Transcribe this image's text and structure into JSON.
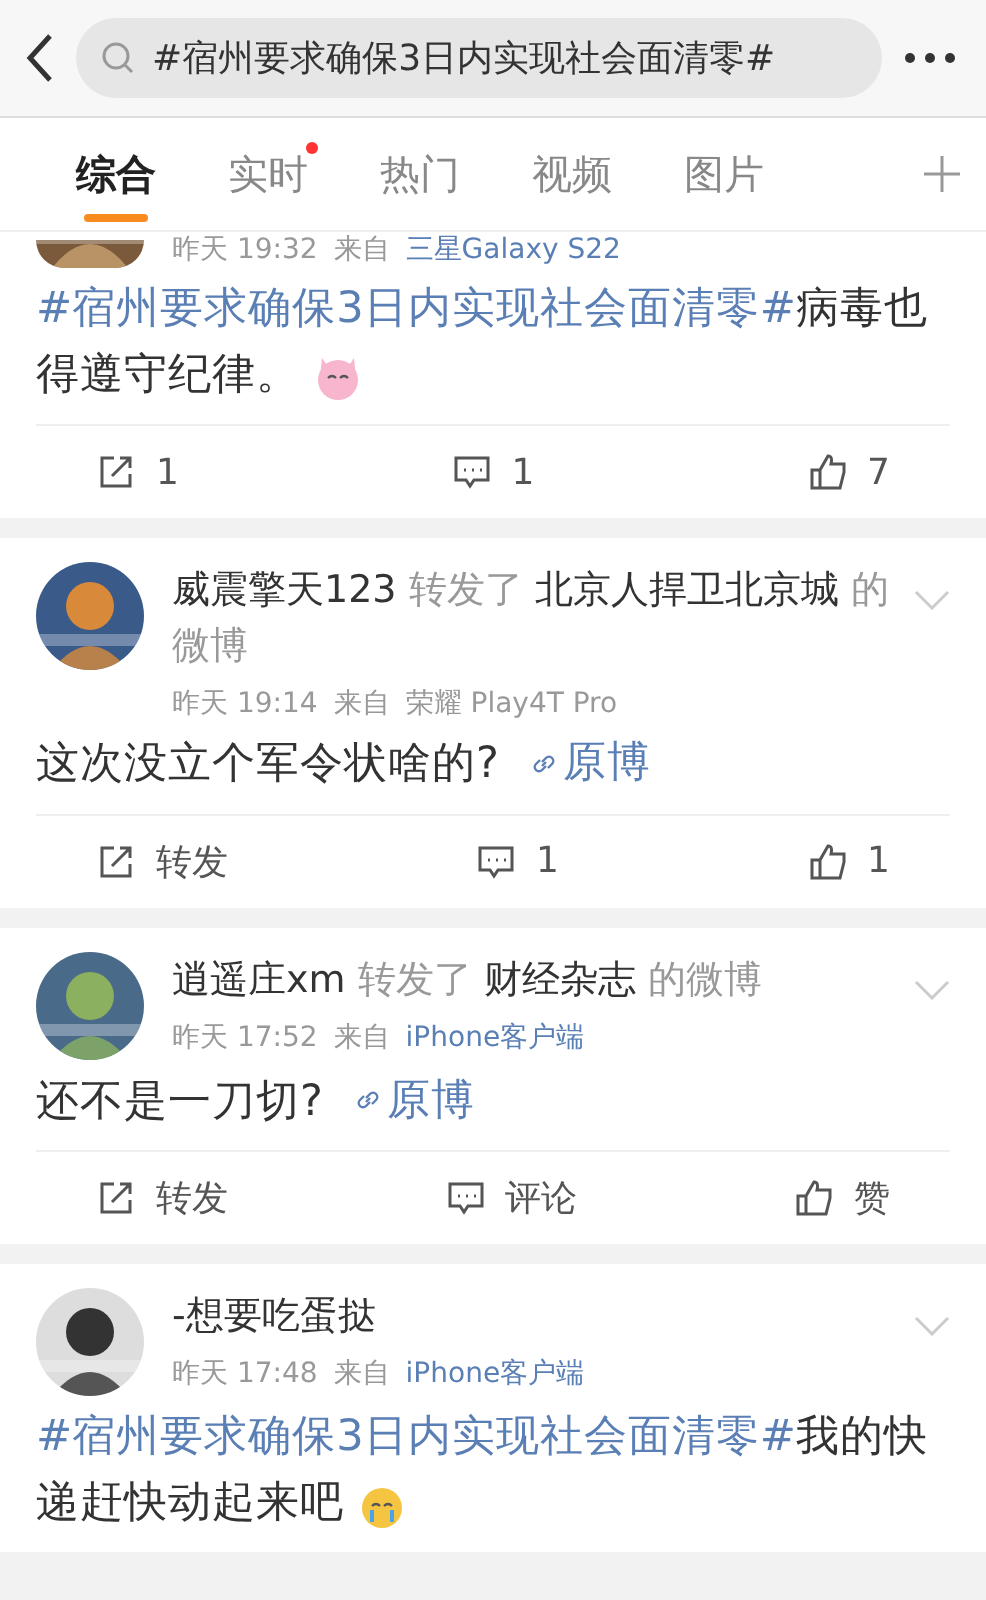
{
  "search": {
    "query": "#宿州要求确保3日内实现社会面清零#"
  },
  "tabs": [
    {
      "label": "综合",
      "selected": true,
      "dot": false
    },
    {
      "label": "实时",
      "selected": false,
      "dot": true
    },
    {
      "label": "热门",
      "selected": false,
      "dot": false
    },
    {
      "label": "视频",
      "selected": false,
      "dot": false
    },
    {
      "label": "图片",
      "selected": false,
      "dot": false
    }
  ],
  "posts": [
    {
      "avatar_cut": true,
      "time": "昨天 19:32",
      "source_prefix": "来自",
      "device": "三星Galaxy S22",
      "device_link": true,
      "menu": false,
      "content": [
        {
          "kind": "topic",
          "text": "#宿州要求确保3日内实现社会面清零#"
        },
        {
          "kind": "text",
          "text": "病毒也得遵守纪律。"
        },
        {
          "kind": "emoji_pink"
        }
      ],
      "actions": [
        {
          "kind": "repost",
          "label": "1"
        },
        {
          "kind": "comment",
          "label": "1"
        },
        {
          "kind": "like",
          "label": "7"
        }
      ]
    },
    {
      "avatar_cut": false,
      "header": [
        {
          "kind": "name",
          "text": "威震擎天123"
        },
        {
          "kind": "muted",
          "text": "转发了"
        },
        {
          "kind": "name",
          "text": "北京人捍卫北京城"
        },
        {
          "kind": "muted",
          "text": "的微博"
        }
      ],
      "time": "昨天 19:14",
      "source_prefix": "来自",
      "device": "荣耀 Play4T Pro",
      "device_link": false,
      "menu": true,
      "content": [
        {
          "kind": "text",
          "text": "这次没立个军令状啥的?"
        },
        {
          "kind": "link",
          "text": "原博"
        }
      ],
      "actions": [
        {
          "kind": "repost",
          "label": "转发"
        },
        {
          "kind": "comment",
          "label": "1"
        },
        {
          "kind": "like",
          "label": "1"
        }
      ]
    },
    {
      "avatar_cut": false,
      "header": [
        {
          "kind": "name",
          "text": "逍遥庄xm"
        },
        {
          "kind": "muted",
          "text": "转发了"
        },
        {
          "kind": "name",
          "text": "财经杂志"
        },
        {
          "kind": "muted",
          "text": "的微博"
        }
      ],
      "time": "昨天 17:52",
      "source_prefix": "来自",
      "device": "iPhone客户端",
      "device_link": true,
      "menu": true,
      "content": [
        {
          "kind": "text",
          "text": "还不是一刀切?"
        },
        {
          "kind": "link",
          "text": "原博"
        }
      ],
      "actions": [
        {
          "kind": "repost",
          "label": "转发"
        },
        {
          "kind": "comment",
          "label": "评论"
        },
        {
          "kind": "like",
          "label": "赞"
        }
      ]
    },
    {
      "avatar_cut": false,
      "header": [
        {
          "kind": "name",
          "text": "-想要吃蛋挞"
        }
      ],
      "time": "昨天 17:48",
      "source_prefix": "来自",
      "device": "iPhone客户端",
      "device_link": true,
      "menu": true,
      "content": [
        {
          "kind": "topic",
          "text": "#宿州要求确保3日内实现社会面清零#"
        },
        {
          "kind": "text",
          "text": "我的快递赶快动起来吧"
        },
        {
          "kind": "emoji_yellow"
        }
      ]
    }
  ]
}
